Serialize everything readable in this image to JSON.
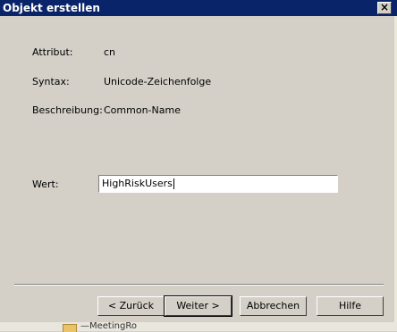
{
  "dialog": {
    "title": "Objekt erstellen",
    "close_glyph": "×"
  },
  "fields": {
    "attribut_label": "Attribut:",
    "attribut_value": "cn",
    "syntax_label": "Syntax:",
    "syntax_value": "Unicode-Zeichenfolge",
    "beschreibung_label": "Beschreibung:",
    "beschreibung_value": "Common-Name",
    "wert_label": "Wert:",
    "wert_value": "HighRiskUsers"
  },
  "buttons": {
    "back": "< Zurück",
    "next": "Weiter >",
    "cancel": "Abbrechen",
    "help": "Hilfe"
  },
  "background": {
    "fragment_text": "—MeetingRo"
  }
}
